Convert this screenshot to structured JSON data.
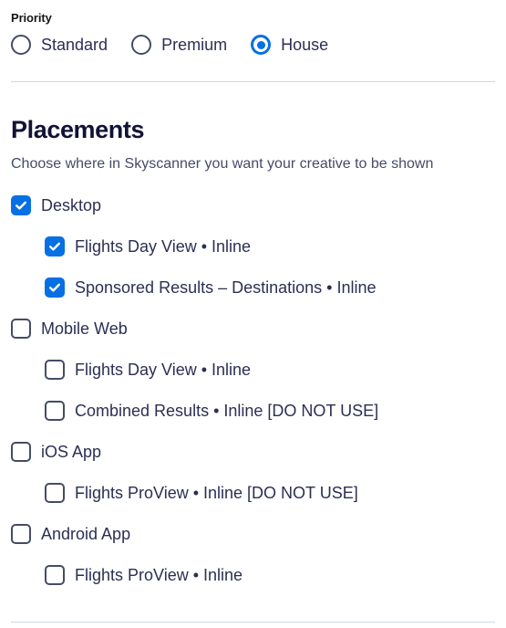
{
  "colors": {
    "accent": "#0770E3",
    "text": "#2B2F53",
    "heading": "#111236",
    "muted": "#444C66",
    "divider": "#CDD9EA",
    "control_border": "#444C66"
  },
  "priority": {
    "label": "Priority",
    "options": [
      {
        "label": "Standard",
        "selected": false
      },
      {
        "label": "Premium",
        "selected": false
      },
      {
        "label": "House",
        "selected": true
      }
    ]
  },
  "placements": {
    "title": "Placements",
    "subtitle": "Choose where in Skyscanner you want your creative to be shown",
    "groups": [
      {
        "label": "Desktop",
        "checked": true,
        "children": [
          {
            "label": "Flights Day View • Inline",
            "checked": true
          },
          {
            "label": "Sponsored Results – Destinations • Inline",
            "checked": true
          }
        ]
      },
      {
        "label": "Mobile Web",
        "checked": false,
        "children": [
          {
            "label": "Flights Day View • Inline",
            "checked": false
          },
          {
            "label": "Combined Results • Inline [DO NOT USE]",
            "checked": false
          }
        ]
      },
      {
        "label": "iOS App",
        "checked": false,
        "children": [
          {
            "label": "Flights ProView • Inline [DO NOT USE]",
            "checked": false
          }
        ]
      },
      {
        "label": "Android App",
        "checked": false,
        "children": [
          {
            "label": "Flights ProView • Inline",
            "checked": false
          }
        ]
      }
    ]
  }
}
